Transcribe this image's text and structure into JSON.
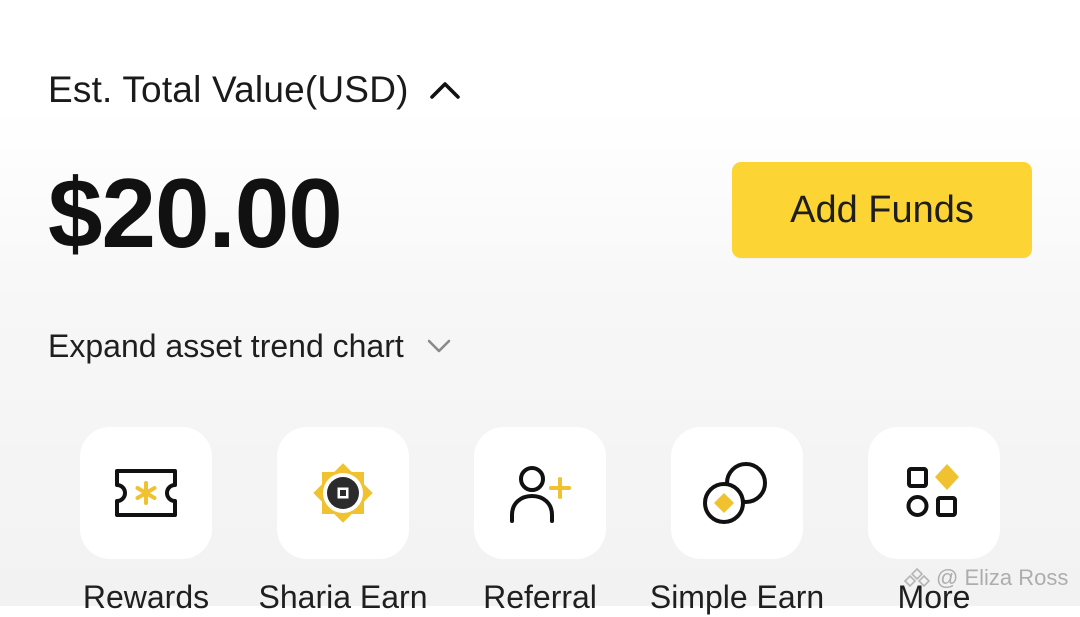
{
  "header": {
    "title": "Est. Total Value(USD)",
    "toggle_icon": "chevron-up-icon"
  },
  "balance": {
    "amount": "$20.00"
  },
  "actions": {
    "add_funds_label": "Add Funds"
  },
  "trend": {
    "expand_label": "Expand asset trend chart",
    "toggle_icon": "chevron-down-icon"
  },
  "shortcuts": [
    {
      "label": "Rewards",
      "icon": "ticket-star-icon"
    },
    {
      "label": "Sharia Earn",
      "icon": "sharia-coin-icon"
    },
    {
      "label": "Referral",
      "icon": "add-user-icon"
    },
    {
      "label": "Simple Earn",
      "icon": "coins-icon"
    },
    {
      "label": "More",
      "icon": "apps-grid-icon"
    }
  ],
  "watermark": {
    "text": "@ Eliza Ross"
  },
  "colors": {
    "accent_yellow": "#fcd535",
    "icon_yellow": "#f0c230",
    "text_primary": "#111111",
    "tile_background": "#ffffff"
  }
}
